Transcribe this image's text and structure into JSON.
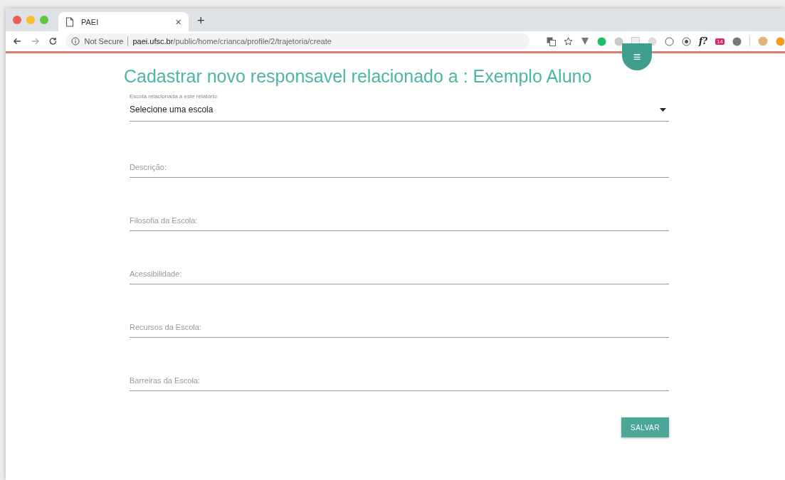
{
  "browser": {
    "tab": {
      "title": "PAEI",
      "close": "×"
    },
    "new_tab": "+",
    "address": {
      "security": "Not Secure",
      "host": "paei.ufsc.br",
      "path": "/public/home/crianca/profile/2/trajetoria/create"
    },
    "extensions": [
      {
        "kind": "translate"
      },
      {
        "kind": "star"
      },
      {
        "kind": "shield"
      },
      {
        "kind": "dot",
        "color": "#1fbf6a"
      },
      {
        "kind": "dot",
        "color": "#c8c8c8"
      },
      {
        "kind": "square"
      },
      {
        "kind": "dot",
        "color": "#dddddd"
      },
      {
        "kind": "ring"
      },
      {
        "kind": "ring-a"
      },
      {
        "kind": "text",
        "text": "f?"
      },
      {
        "kind": "badge",
        "text": "14"
      },
      {
        "kind": "dot",
        "color": "#777777"
      },
      {
        "kind": "divider"
      },
      {
        "kind": "avatar"
      },
      {
        "kind": "dot",
        "color": "#f29b1d"
      }
    ]
  },
  "page": {
    "menu_button": "≡",
    "title": "Cadastrar novo responsavel relacionado a : Exemplo Aluno",
    "select": {
      "label": "Escola relacionada a este relatório:",
      "value": "Selecione uma escola"
    },
    "fields": [
      {
        "placeholder": "Descrição:"
      },
      {
        "placeholder": "Filosofia da Escola:"
      },
      {
        "placeholder": "Acessibilidade:"
      },
      {
        "placeholder": "Recursos da Escola:"
      },
      {
        "placeholder": "Barreiras da Escola:"
      }
    ],
    "submit": "SALVAR"
  }
}
